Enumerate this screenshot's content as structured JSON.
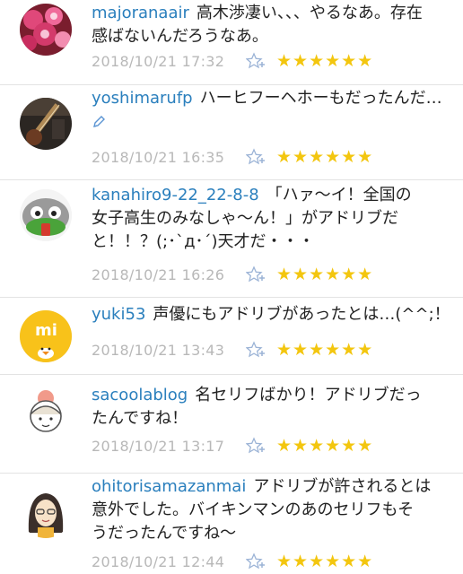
{
  "comments": [
    {
      "username": "majoranaair",
      "lines": [
        "高木渉凄い、、、やるなあ。存在",
        "感ばないんだろうなあ。"
      ],
      "timestamp": "2018/10/21 17:32",
      "stars": "★★★★★★"
    },
    {
      "username": "yoshimarufp",
      "lines": [
        "ハーヒフーヘホーもだったんだ…"
      ],
      "timestamp": "2018/10/21 16:35",
      "stars": "★★★★★★"
    },
    {
      "username": "kanahiro9-22_22-8-8",
      "lines": [
        "「ハァ〜イ！全国の",
        "女子高生のみなしゃ〜ん！」がアドリブだ",
        "と！！？(;･`д･´)天才だ・・・"
      ],
      "timestamp": "2018/10/21 16:26",
      "stars": "★★★★★★"
    },
    {
      "username": "yuki53",
      "lines": [
        "声優にもアドリブがあったとは…(^^;！"
      ],
      "timestamp": "2018/10/21 13:43",
      "stars": "★★★★★★"
    },
    {
      "username": "sacoolablog",
      "lines": [
        "名セリフばかり！アドリブだっ",
        "たんですね！"
      ],
      "timestamp": "2018/10/21 13:17",
      "stars": "★★★★★★"
    },
    {
      "username": "ohitorisamazanmai",
      "lines": [
        "アドリブが許されるとは",
        "意外でした。バイキンマンのあのセリフもそ",
        "うだったんですね〜"
      ],
      "timestamp": "2018/10/21 12:44",
      "stars": "★★★★★★"
    }
  ],
  "colors": {
    "username": "#2a7fbd",
    "star": "#f3c60f",
    "timestamp": "#b8b8b8",
    "divider": "#e3e3e3"
  },
  "icons": {
    "favorite": "add-star-icon",
    "edit": "pencil-icon"
  }
}
